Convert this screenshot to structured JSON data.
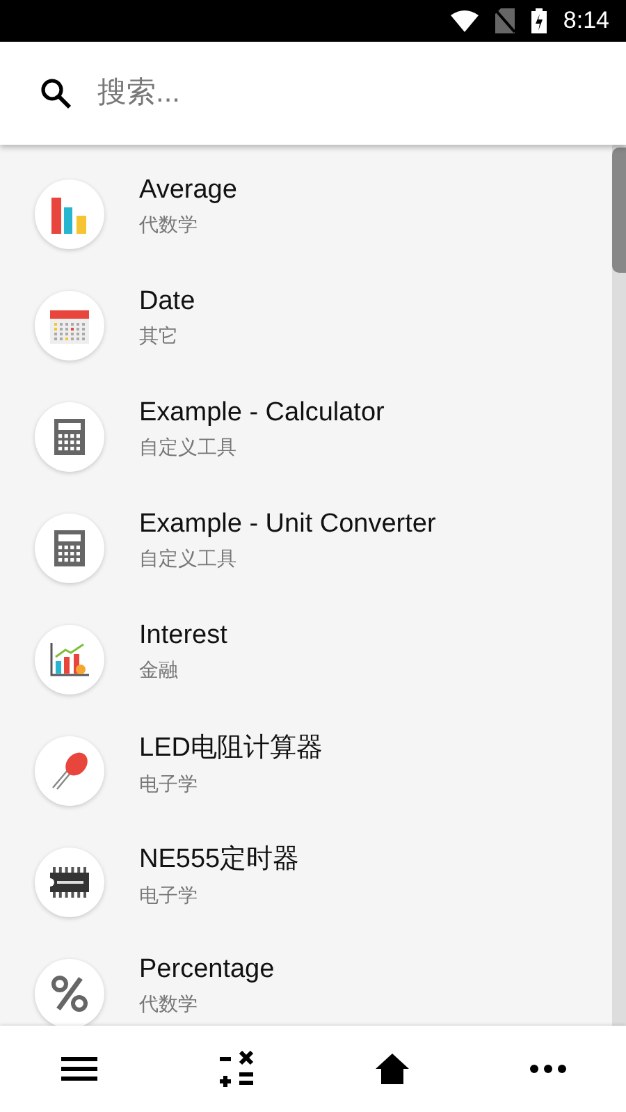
{
  "status_bar": {
    "time": "8:14"
  },
  "search": {
    "placeholder": "搜索..."
  },
  "items": [
    {
      "title": "Average",
      "category": "代数学"
    },
    {
      "title": "Date",
      "category": "其它"
    },
    {
      "title": "Example - Calculator",
      "category": "自定义工具"
    },
    {
      "title": "Example - Unit Converter",
      "category": "自定义工具"
    },
    {
      "title": "Interest",
      "category": "金融"
    },
    {
      "title": "LED电阻计算器",
      "category": "电子学"
    },
    {
      "title": "NE555定时器",
      "category": "电子学"
    },
    {
      "title": "Percentage",
      "category": "代数学"
    }
  ]
}
